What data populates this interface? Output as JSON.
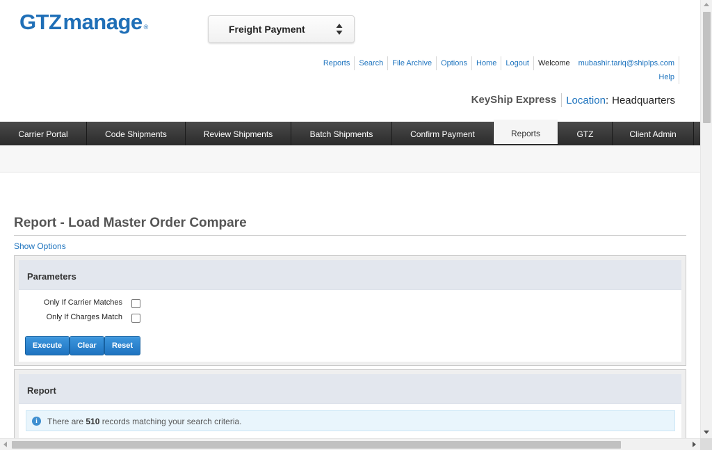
{
  "logo": {
    "gtz": "GTZ",
    "manage": "manage",
    "reg": "®"
  },
  "module_select": {
    "value": "Freight Payment",
    "icon": "sort-arrows-icon"
  },
  "top_links": [
    "Reports",
    "Search",
    "File Archive",
    "Options",
    "Home",
    "Logout"
  ],
  "welcome": {
    "label": "Welcome",
    "user": "mubashir.tariq@shiplps.com"
  },
  "help": "Help",
  "company": {
    "name": "KeyShip Express",
    "location_label": "Location",
    "colon": ":",
    "location": "Headquarters"
  },
  "nav": {
    "items": [
      "Carrier Portal",
      "Code Shipments",
      "Review Shipments",
      "Batch Shipments",
      "Confirm Payment",
      "Reports",
      "GTZ",
      "Client Admin"
    ],
    "active": "Reports"
  },
  "page": {
    "title": "Report - Load Master Order Compare",
    "show_options": "Show Options"
  },
  "parameters": {
    "heading": "Parameters",
    "fields": [
      {
        "label": "Only If Carrier Matches",
        "checked": false
      },
      {
        "label": "Only If Charges Match",
        "checked": false
      }
    ],
    "buttons": {
      "execute": "Execute",
      "clear": "Clear",
      "reset": "Reset"
    }
  },
  "report": {
    "heading": "Report",
    "info": {
      "icon": "info-icon",
      "prefix": "There are",
      "count": "510",
      "suffix": "records matching your search criteria."
    }
  },
  "colors": {
    "brand": "#1f6fb7",
    "link": "#1d73be",
    "navbar": "#333333",
    "button": "#2a84d0"
  }
}
